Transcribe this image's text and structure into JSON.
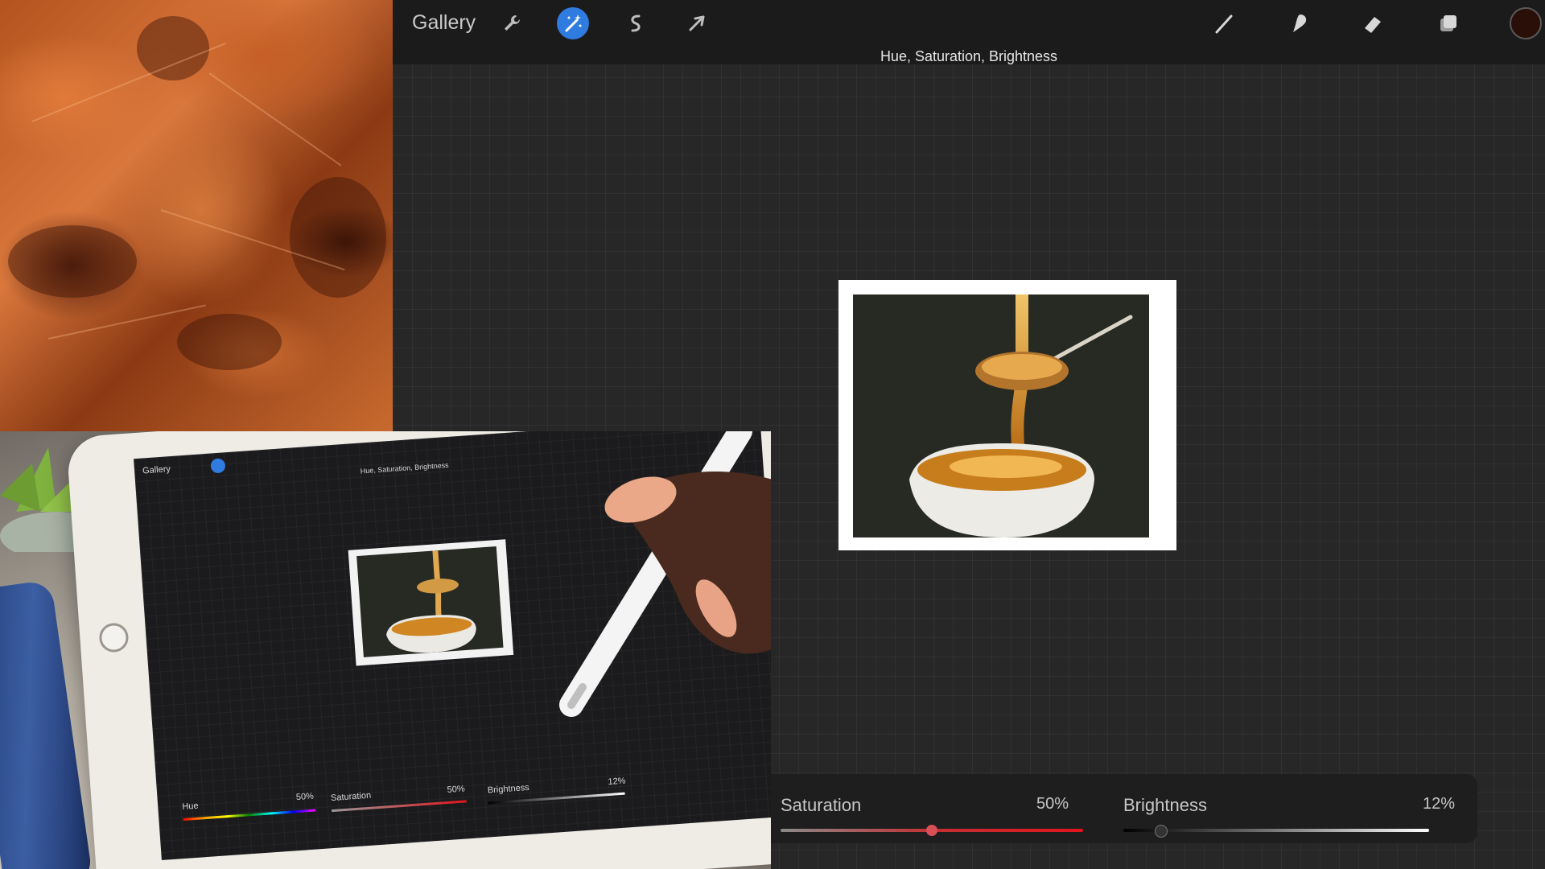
{
  "app": {
    "gallery_label": "Gallery",
    "adjustment_title": "Hue, Saturation, Brightness",
    "tools_left": [
      {
        "name": "wrench-icon",
        "active": false
      },
      {
        "name": "magic-wand-icon",
        "active": true
      },
      {
        "name": "selection-icon",
        "active": false
      },
      {
        "name": "transform-arrow-icon",
        "active": false
      }
    ],
    "tools_right": [
      "brush-icon",
      "smudge-icon",
      "eraser-icon",
      "layers-icon",
      "color-swatch"
    ],
    "current_color": "#2a0f08",
    "accent_color": "#2f7bdf"
  },
  "adjustments": {
    "hue_value_edge": "%",
    "saturation": {
      "label": "Saturation",
      "value_text": "50%",
      "value": 0.5
    },
    "brightness": {
      "label": "Brightness",
      "value_text": "12%",
      "value": 0.12
    }
  },
  "camera_view": {
    "screen": {
      "gallery_label": "Gallery",
      "adjustment_title": "Hue, Saturation, Brightness",
      "hue": {
        "label": "Hue",
        "value_text": "50%",
        "value": 0.5
      },
      "saturation": {
        "label": "Saturation",
        "value_text": "50%",
        "value": 0.5
      },
      "brightness": {
        "label": "Brightness",
        "value_text": "12%",
        "value": 0.12
      }
    }
  }
}
